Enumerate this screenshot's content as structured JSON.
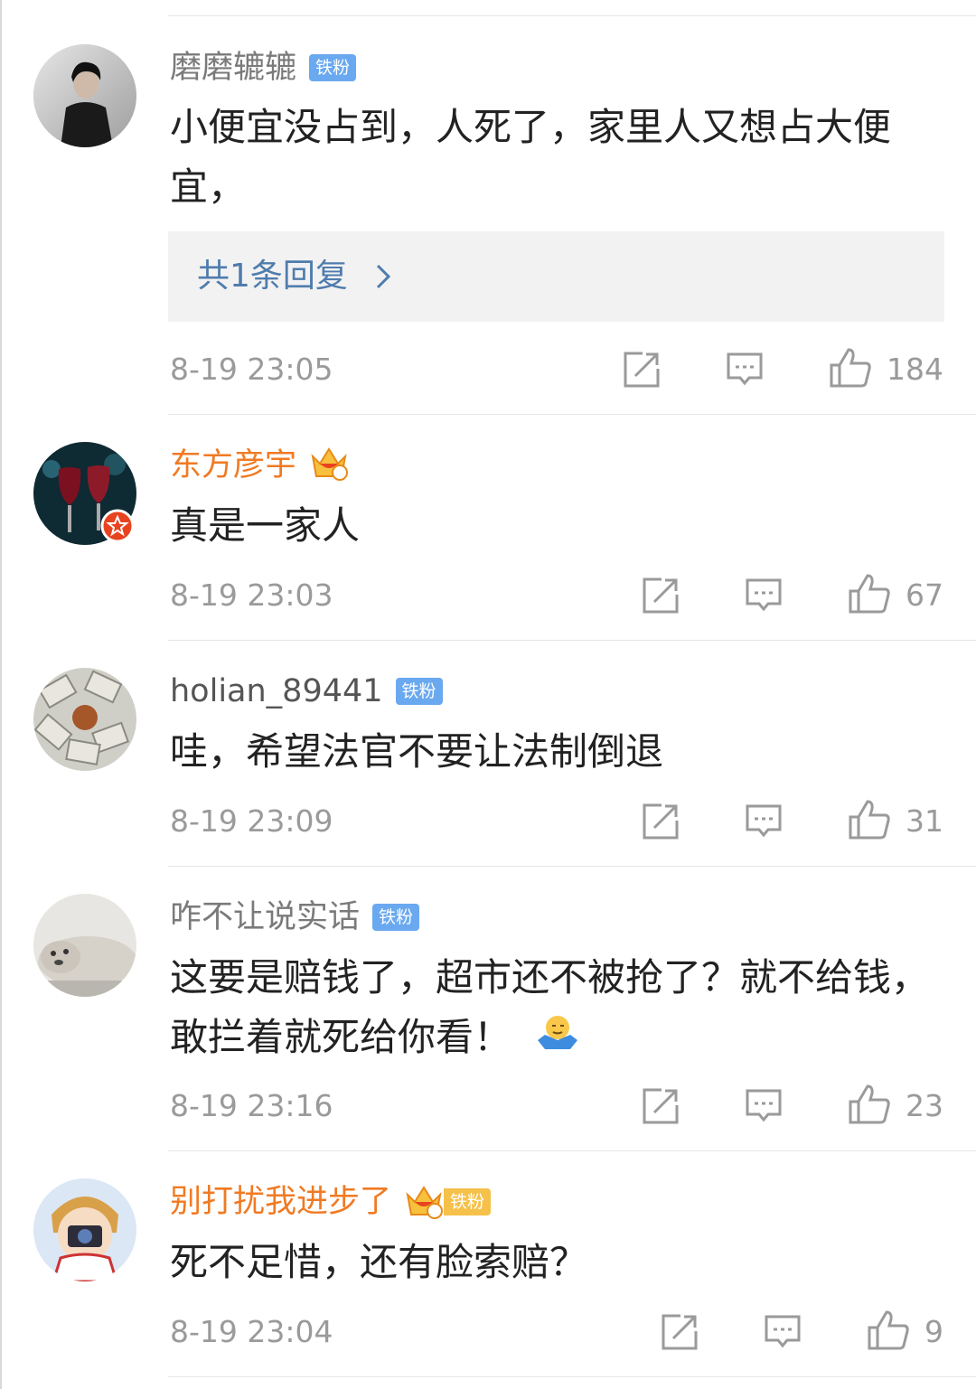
{
  "colors": {
    "name_gray": "#7a7a7a",
    "name_orange": "#f07a23",
    "fan_badge": "#6aa9ef",
    "reply_link": "#4f7cad",
    "meta_gray": "#9a9a9a"
  },
  "comments": [
    {
      "username": "磨磨辘辘",
      "badge": "铁粉",
      "text": "小便宜没占到，人死了，家里人又想占大便宜，",
      "reply_label": "共1条回复",
      "time": "8-19 23:05",
      "likes": "184"
    },
    {
      "username": "东方彦宇",
      "crown_level": "6",
      "text": "真是一家人",
      "time": "8-19 23:03",
      "likes": "67"
    },
    {
      "username": "holian_89441",
      "badge": "铁粉",
      "text": "哇，希望法官不要让法制倒退",
      "time": "8-19 23:09",
      "likes": "31"
    },
    {
      "username": "咋不让说实话",
      "badge": "铁粉",
      "text": "这要是赔钱了，超市还不被抢了？就不给钱，敢拦着就死给你看！",
      "emoji": "shrug-emoji",
      "time": "8-19 23:16",
      "likes": "23"
    },
    {
      "username": "别打扰我进步了",
      "crown_level": "4",
      "badge": "铁粉",
      "text": "死不足惜，还有脸索赔？",
      "time": "8-19 23:04",
      "likes": "9"
    }
  ],
  "icons": {
    "share": "share-icon",
    "comment": "comment-icon",
    "like": "thumbs-up-icon",
    "reply_arrow": "chevron-right-icon"
  }
}
